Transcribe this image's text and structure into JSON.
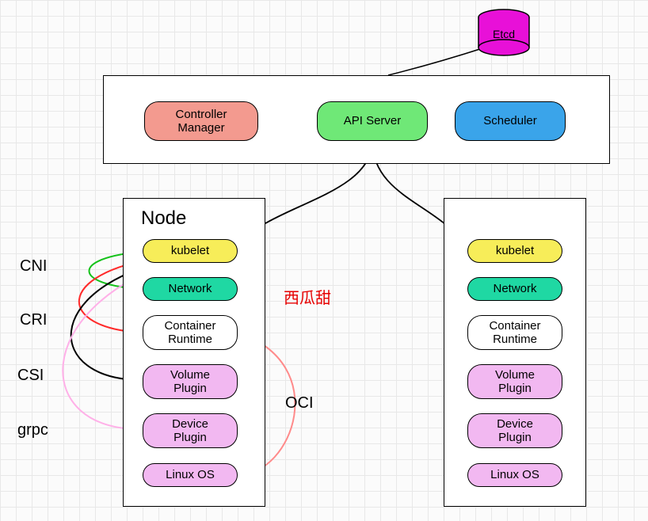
{
  "etcd": "Etcd",
  "control_plane": {
    "controller_manager": "Controller\nManager",
    "api_server": "API Server",
    "scheduler": "Scheduler"
  },
  "node_title": "Node",
  "node_items": {
    "kubelet": "kubelet",
    "network": "Network",
    "runtime": "Container\nRuntime",
    "volume": "Volume\nPlugin",
    "device": "Device\nPlugin",
    "linux": "Linux OS"
  },
  "interface_labels": {
    "cni": "CNI",
    "cri": "CRI",
    "csi": "CSI",
    "grpc": "grpc",
    "oci": "OCI"
  },
  "watermark": "西瓜甜",
  "colors": {
    "etcd": "#e810d8",
    "controller": "#f39a8f",
    "api": "#6fe877",
    "scheduler": "#3aa4ea",
    "kubelet": "#f7ed59",
    "network": "#1fd8a3",
    "plugin": "#f2b8f1",
    "white": "#ffffff"
  }
}
